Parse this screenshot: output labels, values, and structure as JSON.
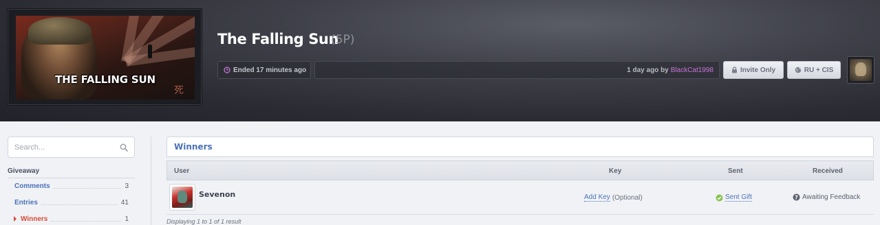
{
  "game": {
    "cover_title": "THE FALLING SUN",
    "cover_kanji": "死",
    "title": "The Falling Sun",
    "points": "(5P)"
  },
  "status": {
    "ended": "Ended 17 minutes ago",
    "created_prefix": "1 day ago by",
    "creator": "BlackCat1998",
    "invite": "Invite Only",
    "region": "RU + CIS"
  },
  "search": {
    "placeholder": "Search..."
  },
  "sidebar": {
    "heading": "Giveaway",
    "items": [
      {
        "label": "Comments",
        "count": "3"
      },
      {
        "label": "Entries",
        "count": "41"
      },
      {
        "label": "Winners",
        "count": "1"
      }
    ]
  },
  "winners": {
    "heading": "Winners",
    "columns": [
      "User",
      "Key",
      "Sent",
      "Received"
    ],
    "rows": [
      {
        "user": "Sevenon",
        "key_link": "Add Key",
        "key_note": "(Optional)",
        "sent": "Sent Gift",
        "received": "Awaiting Feedback"
      }
    ],
    "summary": "Displaying 1 to 1 of 1 result"
  },
  "colors": {
    "accent": "#4b72b8",
    "creator": "#c774d9",
    "active": "#d84a3a",
    "success": "#8cc152"
  }
}
